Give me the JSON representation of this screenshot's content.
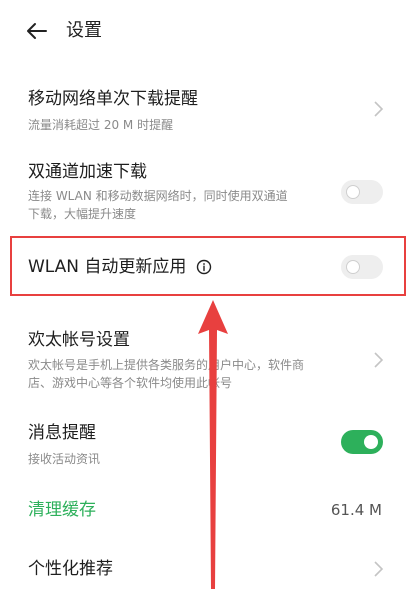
{
  "header": {
    "title": "设置",
    "back_icon": "back-arrow-icon"
  },
  "rows": [
    {
      "title": "移动网络单次下载提醒",
      "subtitle": "流量消耗超过 20 M 时提醒",
      "control": "chevron"
    },
    {
      "title": "双通道加速下载",
      "subtitle_line1": "连接 WLAN 和移动数据网络时，同时使用双通道",
      "subtitle_line2": "下载，大幅提升速度",
      "control": "toggle",
      "toggle_state": "off"
    },
    {
      "title": "WLAN 自动更新应用",
      "control": "toggle",
      "toggle_state": "off",
      "info_icon": "info-icon"
    },
    {
      "title": "欢太帐号设置",
      "subtitle_line1": "欢太帐号是手机上提供各类服务的用户中心，软件商",
      "subtitle_line2": "店、游戏中心等各个软件均使用此帐号",
      "control": "chevron"
    },
    {
      "title": "消息提醒",
      "subtitle": "接收活动资讯",
      "control": "toggle",
      "toggle_state": "on"
    },
    {
      "title": "清理缓存",
      "value": "61.4 M"
    },
    {
      "title": "个性化推荐",
      "control": "chevron"
    }
  ],
  "annotation": {
    "highlight_color": "#e8403f",
    "arrow_color": "#e8403f"
  },
  "colors": {
    "accent_green": "#2db05b",
    "toggle_off_bg": "#eeeeee"
  }
}
